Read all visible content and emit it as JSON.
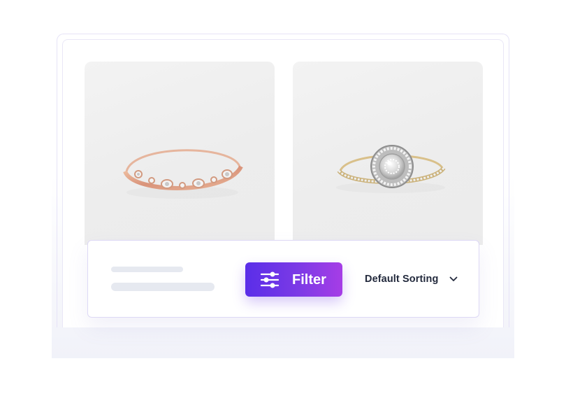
{
  "products": [
    {
      "image": "rose-gold-diamond-band",
      "icon": "ring-image"
    },
    {
      "image": "halo-diamond-engagement-ring",
      "icon": "ring-image"
    }
  ],
  "toolbar": {
    "filter_label": "Filter",
    "filter_icon": "sliders-icon",
    "sort_label": "Default Sorting",
    "sort_icon": "chevron-down-icon"
  },
  "colors": {
    "filter_gradient_start": "#5a2ee8",
    "filter_gradient_end": "#a63de6",
    "sort_text": "#232a3d",
    "skeleton": "#e6e9f0"
  }
}
